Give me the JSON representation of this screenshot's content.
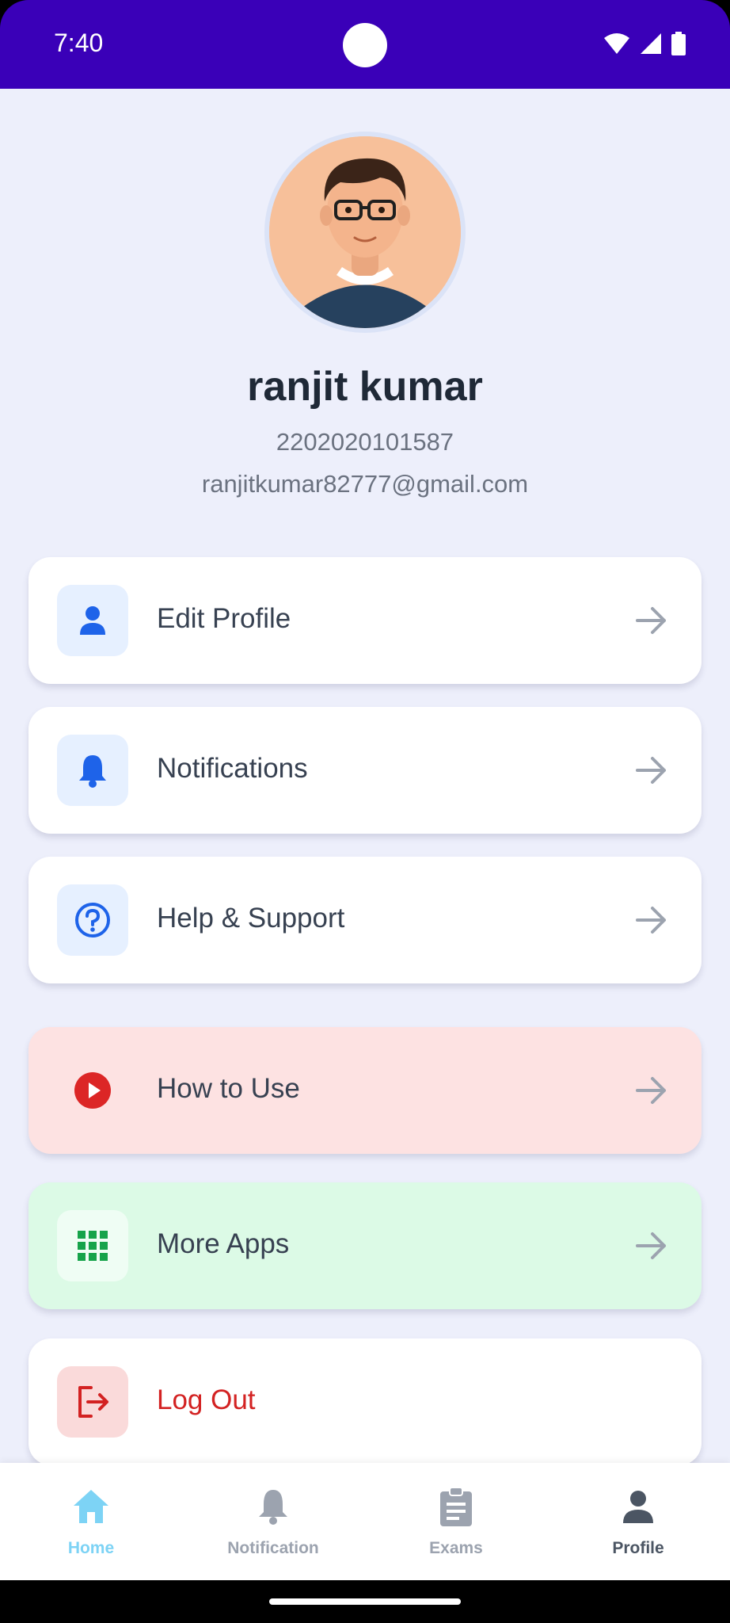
{
  "status_bar": {
    "time": "7:40"
  },
  "profile": {
    "name": "ranjit kumar",
    "id": "2202020101587",
    "email": "ranjitkumar82777@gmail.com"
  },
  "menu": {
    "edit_profile": "Edit Profile",
    "notifications": "Notifications",
    "help_support": "Help & Support",
    "how_to_use": "How to Use",
    "more_apps": "More Apps",
    "log_out": "Log Out"
  },
  "bottom_nav": {
    "home": "Home",
    "notification": "Notification",
    "exams": "Exams",
    "profile": "Profile"
  },
  "colors": {
    "status_bar": "#3a00b8",
    "background": "#edeffb",
    "accent_blue": "#1e63e9",
    "danger_red": "#d32222",
    "success_green": "#16a34a",
    "nav_active": "#7dd3f5"
  }
}
